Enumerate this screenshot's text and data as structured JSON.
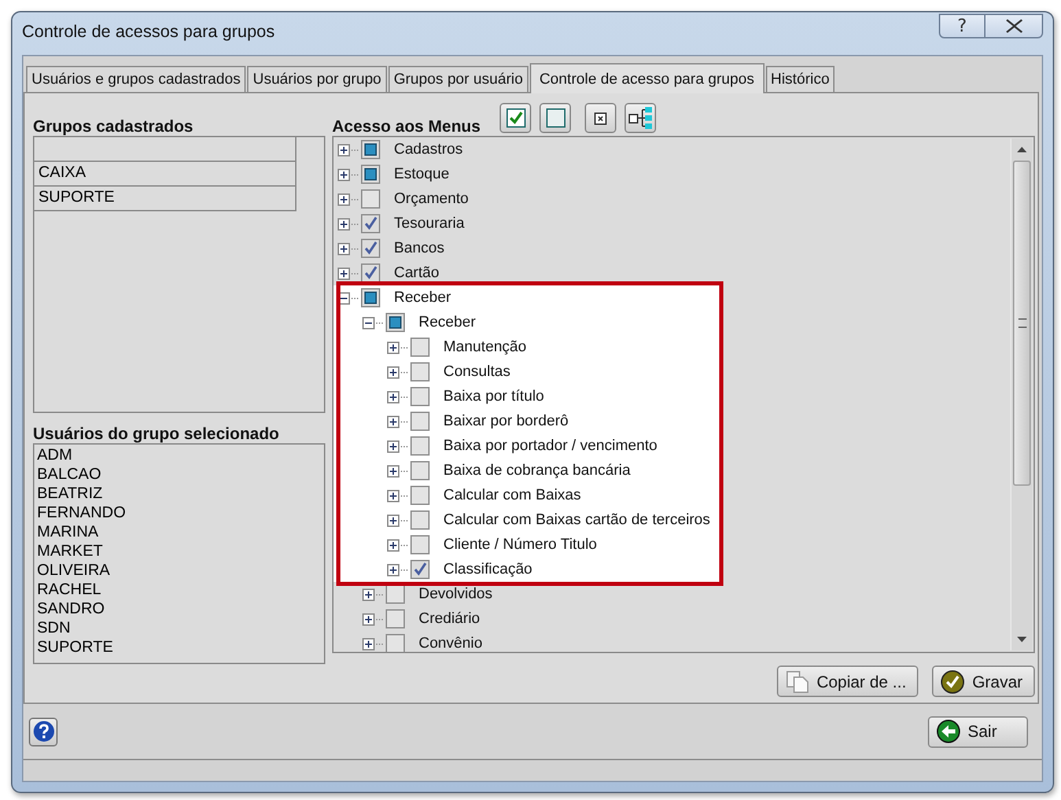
{
  "window": {
    "title": "Controle de acessos para grupos",
    "help_button": "?"
  },
  "tabs": [
    {
      "label": "Usuários e grupos cadastrados",
      "selected": false
    },
    {
      "label": "Usuários por grupo",
      "selected": false
    },
    {
      "label": "Grupos por usuário",
      "selected": false
    },
    {
      "label": "Controle de acesso para grupos",
      "selected": true
    },
    {
      "label": "Histórico",
      "selected": false
    }
  ],
  "groups": {
    "title": "Grupos cadastrados",
    "rows": [
      "CAIXA",
      "SUPORTE"
    ]
  },
  "users": {
    "title": "Usuários do grupo selecionado",
    "items": [
      "ADM",
      "BALCAO",
      "BEATRIZ",
      "FERNANDO",
      "MARINA",
      "MARKET",
      "OLIVEIRA",
      "RACHEL",
      "SANDRO",
      "SDN",
      "SUPORTE"
    ]
  },
  "menus": {
    "title": "Acesso aos Menus",
    "toolbar": [
      {
        "kind": "check"
      },
      {
        "kind": "uncheck"
      },
      {
        "kind": "collapse"
      },
      {
        "kind": "expand"
      }
    ],
    "tree": [
      {
        "label": "Cadastros",
        "checked": false,
        "partial": true,
        "expanded": false,
        "highlighted": false
      },
      {
        "label": "Estoque",
        "checked": false,
        "partial": true,
        "expanded": false,
        "highlighted": false
      },
      {
        "label": "Orçamento",
        "checked": false,
        "partial": false,
        "expanded": false,
        "highlighted": false
      },
      {
        "label": "Tesouraria",
        "checked": true,
        "partial": false,
        "expanded": false,
        "highlighted": false
      },
      {
        "label": "Bancos",
        "checked": true,
        "partial": false,
        "expanded": false,
        "highlighted": false
      },
      {
        "label": "Cartão",
        "checked": true,
        "partial": false,
        "expanded": false,
        "highlighted": false
      },
      {
        "label": "Receber",
        "checked": false,
        "partial": true,
        "expanded": true,
        "highlighted": true,
        "children": [
          {
            "label": "Receber",
            "checked": false,
            "partial": true,
            "expanded": true,
            "highlighted": true,
            "children": [
              {
                "label": "Manutenção",
                "checked": false,
                "partial": false,
                "expanded": false,
                "highlighted": true
              },
              {
                "label": "Consultas",
                "checked": false,
                "partial": false,
                "expanded": false,
                "highlighted": true
              },
              {
                "label": "Baixa por título",
                "checked": false,
                "partial": false,
                "expanded": false,
                "highlighted": true
              },
              {
                "label": "Baixar por borderô",
                "checked": false,
                "partial": false,
                "expanded": false,
                "highlighted": true
              },
              {
                "label": "Baixa por portador / vencimento",
                "checked": false,
                "partial": false,
                "expanded": false,
                "highlighted": true
              },
              {
                "label": "Baixa de cobrança bancária",
                "checked": false,
                "partial": false,
                "expanded": false,
                "highlighted": true
              },
              {
                "label": "Calcular com Baixas",
                "checked": false,
                "partial": false,
                "expanded": false,
                "highlighted": true
              },
              {
                "label": "Calcular com Baixas cartão de terceiros",
                "checked": false,
                "partial": false,
                "expanded": false,
                "highlighted": true
              },
              {
                "label": "Cliente / Número Titulo",
                "checked": false,
                "partial": false,
                "expanded": false,
                "highlighted": true
              },
              {
                "label": "Classificação",
                "checked": true,
                "partial": false,
                "expanded": false,
                "highlighted": true
              }
            ]
          },
          {
            "label": "Devolvidos",
            "checked": false,
            "partial": false,
            "expanded": false,
            "highlighted": false
          },
          {
            "label": "Crediário",
            "checked": false,
            "partial": false,
            "expanded": false,
            "highlighted": false
          },
          {
            "label": "Convênio",
            "checked": false,
            "partial": false,
            "expanded": false,
            "highlighted": false
          }
        ]
      }
    ]
  },
  "buttons": {
    "copy": "Copiar de ...",
    "save": "Gravar",
    "exit": "Sair"
  }
}
